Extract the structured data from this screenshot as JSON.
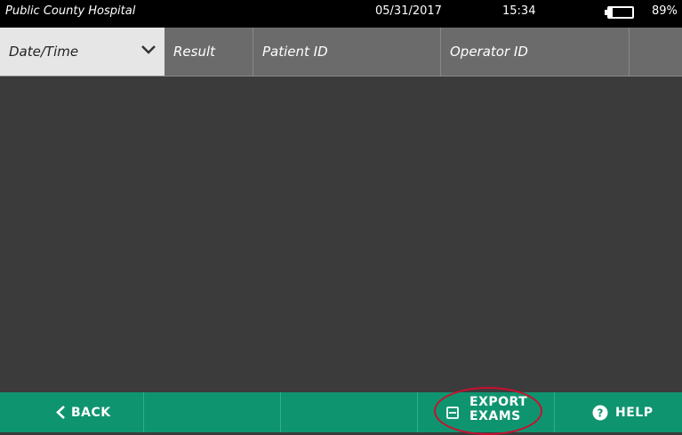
{
  "status_bar": {
    "facility": "Public County Hospital",
    "date": "05/31/2017",
    "time": "15:34",
    "battery_percent": "89%",
    "battery_level": 0.89
  },
  "columns": [
    {
      "label": "Date/Time",
      "sorted": true
    },
    {
      "label": "Result"
    },
    {
      "label": "Patient ID"
    },
    {
      "label": "Operator ID"
    },
    {
      "label": ""
    }
  ],
  "rows": [],
  "footer": {
    "back_label": "BACK",
    "export_label_line1": "EXPORT",
    "export_label_line2": "EXAMS",
    "help_label": "HELP"
  },
  "colors": {
    "footer": "#0f9470",
    "highlight": "#c8102e",
    "content_bg": "#3b3b3c"
  },
  "icons": {
    "sort": "chevron-down-icon",
    "back": "chevron-left-icon",
    "export": "save-icon",
    "help": "question-circle-icon"
  }
}
